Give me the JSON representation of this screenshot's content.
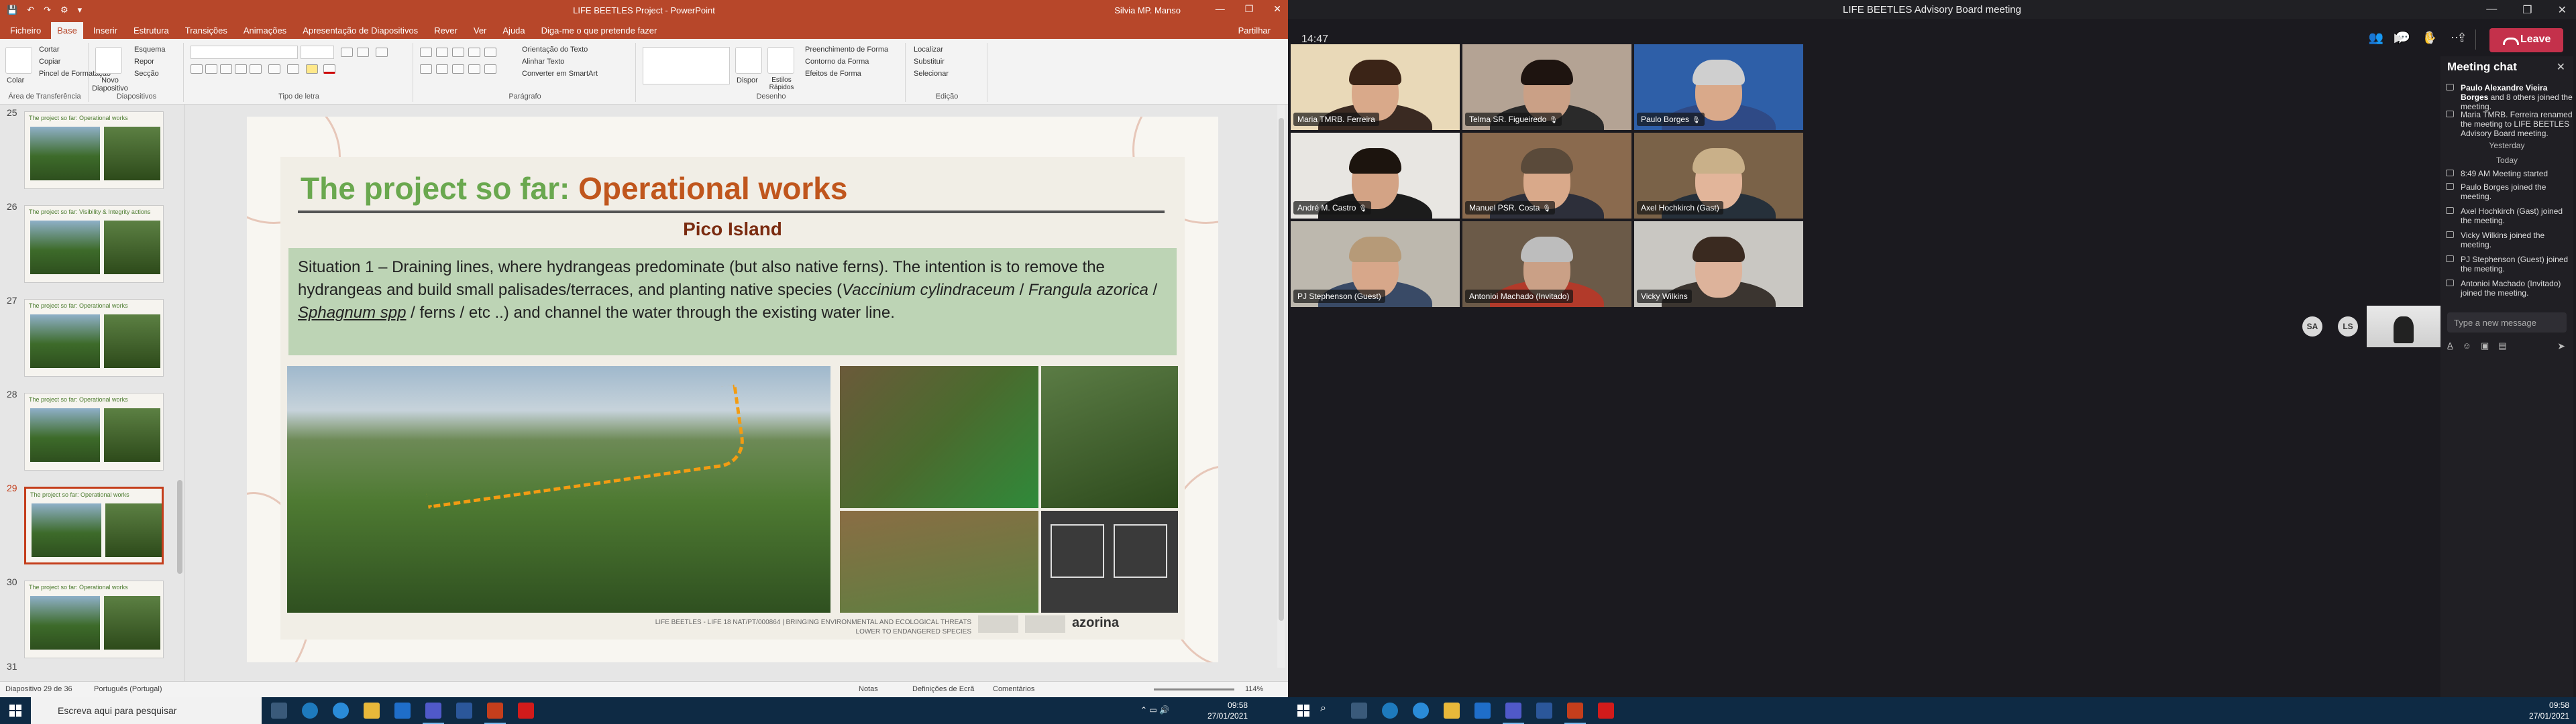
{
  "powerpoint": {
    "quick_access": [
      "💾",
      "↶",
      "↷",
      "⚙",
      "▾"
    ],
    "title": "LIFE BEETLES Project  -  PowerPoint",
    "user": "Silvia MP. Manso",
    "window_controls": [
      "—",
      "❐",
      "✕"
    ],
    "tabs": [
      "Ficheiro",
      "Base",
      "Inserir",
      "Estrutura",
      "Transições",
      "Animações",
      "Apresentação de Diapositivos",
      "Rever",
      "Ver",
      "Ajuda",
      "Diga-me o que pretende fazer"
    ],
    "share": "Partilhar",
    "ribbon": {
      "clipboard": {
        "label": "Área de Transferência",
        "paste": "Colar",
        "cut": "Cortar",
        "copy": "Copiar",
        "format_painter": "Pincel de Formatação"
      },
      "slides": {
        "label": "Diapositivos",
        "new_slide": "Novo Diapositivo",
        "layout": "Esquema",
        "reset": "Repor",
        "section": "Secção"
      },
      "font": {
        "label": "Tipo de letra",
        "name": "",
        "size": ""
      },
      "paragraph": {
        "label": "Parágrafo",
        "text_direction": "Orientação do Texto",
        "align_text": "Alinhar Texto",
        "smartart": "Converter em SmartArt"
      },
      "drawing": {
        "label": "Desenho",
        "arrange": "Dispor",
        "quick_styles": "Estilos Rápidos",
        "shape_fill": "Preenchimento de Forma",
        "shape_outline": "Contorno da Forma",
        "shape_effects": "Efeitos de Forma"
      },
      "editing": {
        "label": "Edição",
        "find": "Localizar",
        "replace": "Substituir",
        "select": "Selecionar"
      }
    },
    "thumbnails": [
      {
        "num": "25",
        "title": "The project so far: Operational works"
      },
      {
        "num": "26",
        "title": "The project so far: Visibility & Integrity actions"
      },
      {
        "num": "27",
        "title": "The project so far: Operational works"
      },
      {
        "num": "28",
        "title": "The project so far: Operational works"
      },
      {
        "num": "29",
        "title": "The project so far: Operational works"
      },
      {
        "num": "30",
        "title": "The project so far: Operational works"
      },
      {
        "num": "31",
        "title": ""
      }
    ],
    "slide": {
      "title_a": "The project so far: ",
      "title_b": "Operational works",
      "subtitle": "Pico Island",
      "text_1": "Situation 1 – Draining lines, where hydrangeas predominate (but also native ferns). The intention is to remove the hydrangeas and build small palisades/terraces, and planting native species (",
      "text_i1": "Vaccinium cylindraceum",
      "text_2": " / ",
      "text_i2": "Frangula azorica",
      "text_3": " / ",
      "text_i3": "Sphagnum spp",
      "text_4": " / ferns / etc ..) and channel the water through the existing water line.",
      "footer_1": "LIFE BEETLES - LIFE 18 NAT/PT/000864 | BRINGING ENVIRONMENTAL AND ECOLOGICAL THREATS",
      "footer_2": "LOWER TO ENDANGERED SPECIES",
      "logo_text": "azorina"
    },
    "status": {
      "slide_count": "Diapositivo 29 de 36",
      "language": "Português (Portugal)",
      "notes": "Notas",
      "display": "Definições de Ecrã",
      "comments": "Comentários",
      "zoom": "114%"
    }
  },
  "taskbar_left": {
    "search_placeholder": "Escreva aqui para pesquisar",
    "time": "09:58",
    "date": "27/01/2021"
  },
  "taskbar_right": {
    "time": "09:58",
    "date": "27/01/2021"
  },
  "teams": {
    "title": "LIFE BEETLES Advisory Board meeting",
    "window_controls": [
      "—",
      "❐",
      "✕"
    ],
    "call_time": "14:47",
    "leave": "Leave",
    "participants": [
      {
        "name": "Maria TMRB. Ferreira",
        "muted": false,
        "bg": "#e9d9b8",
        "torso": "#3a2a22",
        "hair": "#3b2417",
        "face": "#d9a98a"
      },
      {
        "name": "Telma SR. Figueiredo",
        "muted": true,
        "bg": "#b4a394",
        "torso": "#2a2a2a",
        "hair": "#1e1410",
        "face": "#caa086"
      },
      {
        "name": "Paulo Borges",
        "muted": true,
        "bg": "#2e5fa8",
        "torso": "#2f4a86",
        "hair": "#cfcfcf",
        "face": "#d9a98a"
      },
      {
        "name": "André M. Castro",
        "muted": true,
        "bg": "#e8e6e2",
        "torso": "#1c1c1c",
        "hair": "#1c140e",
        "face": "#d3a385"
      },
      {
        "name": "Manuel PSR. Costa",
        "muted": true,
        "bg": "#8a6a4e",
        "torso": "#2d2f3a",
        "hair": "#5a4a3a",
        "face": "#d9a98a"
      },
      {
        "name": "Axel Hochkirch (Gast)",
        "muted": false,
        "bg": "#7a6248",
        "torso": "#26303a",
        "hair": "#c9b089",
        "face": "#e2b59a"
      },
      {
        "name": "PJ Stephenson (Guest)",
        "muted": true,
        "bg": "#bdb8ae",
        "torso": "#394a66",
        "hair": "#b69a78",
        "face": "#d7a78a"
      },
      {
        "name": "Antonioi Machado (Invitado)",
        "muted": false,
        "bg": "#6b5a48",
        "torso": "#b23a2a",
        "hair": "#bdbdbd",
        "face": "#caa086"
      },
      {
        "name": "Vicky Wilkins",
        "muted": false,
        "bg": "#c9c7c2",
        "torso": "#3b3530",
        "hair": "#3a2a20",
        "face": "#ddb39b"
      }
    ],
    "avatars": [
      "SA",
      "LS"
    ],
    "chat": {
      "header": "Meeting chat",
      "messages": [
        {
          "bold": "Paulo Alexandre Vieira Borges",
          "rest": " and 8 others joined the meeting."
        },
        {
          "bold": "",
          "rest": "Maria TMRB. Ferreira renamed the meeting to LIFE BEETLES Advisory Board meeting."
        }
      ],
      "yesterday": "Yesterday",
      "today": "Today",
      "events": [
        {
          "text": "8:49 AM     Meeting started"
        },
        {
          "text": "Paulo Borges joined the meeting."
        },
        {
          "text": "Axel Hochkirch (Gast) joined the meeting."
        },
        {
          "text": "Vicky Wilkins joined the meeting."
        },
        {
          "text": "PJ Stephenson (Guest) joined the meeting."
        },
        {
          "text": "Antonioi Machado (Invitado) joined the meeting."
        }
      ],
      "input_placeholder": "Type a new message"
    }
  }
}
